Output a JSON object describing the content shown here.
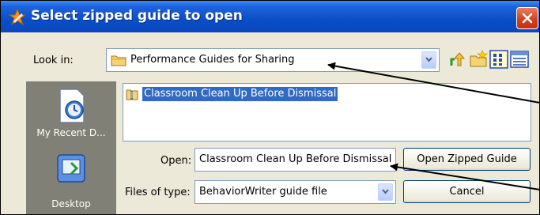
{
  "window": {
    "title": "Select zipped guide to open"
  },
  "look_in": {
    "label": "Look in:",
    "value": "Performance Guides for Sharing"
  },
  "toolbar": {
    "icons": [
      "up-one-level-icon",
      "new-folder-icon",
      "list-view-icon",
      "details-view-icon"
    ]
  },
  "places": {
    "items": [
      {
        "label": "My Recent D...",
        "icon": "recent-documents-icon"
      },
      {
        "label": "Desktop",
        "icon": "desktop-icon"
      }
    ]
  },
  "file_list": {
    "items": [
      {
        "name": "Classroom Clean Up Before Dismissal",
        "selected": true,
        "icon": "zipped-file-icon"
      }
    ]
  },
  "open_field": {
    "label": "Open:",
    "value": "Classroom Clean Up Before Dismissal"
  },
  "files_of_type": {
    "label": "Files of type:",
    "value": "BehaviorWriter guide file"
  },
  "buttons": {
    "open": "Open Zipped Guide",
    "cancel": "Cancel"
  },
  "colors": {
    "titlebar": "#0a4ec8",
    "selection": "#316ac5",
    "places_bar": "#808076",
    "dialog_bg": "#ece9d8"
  }
}
